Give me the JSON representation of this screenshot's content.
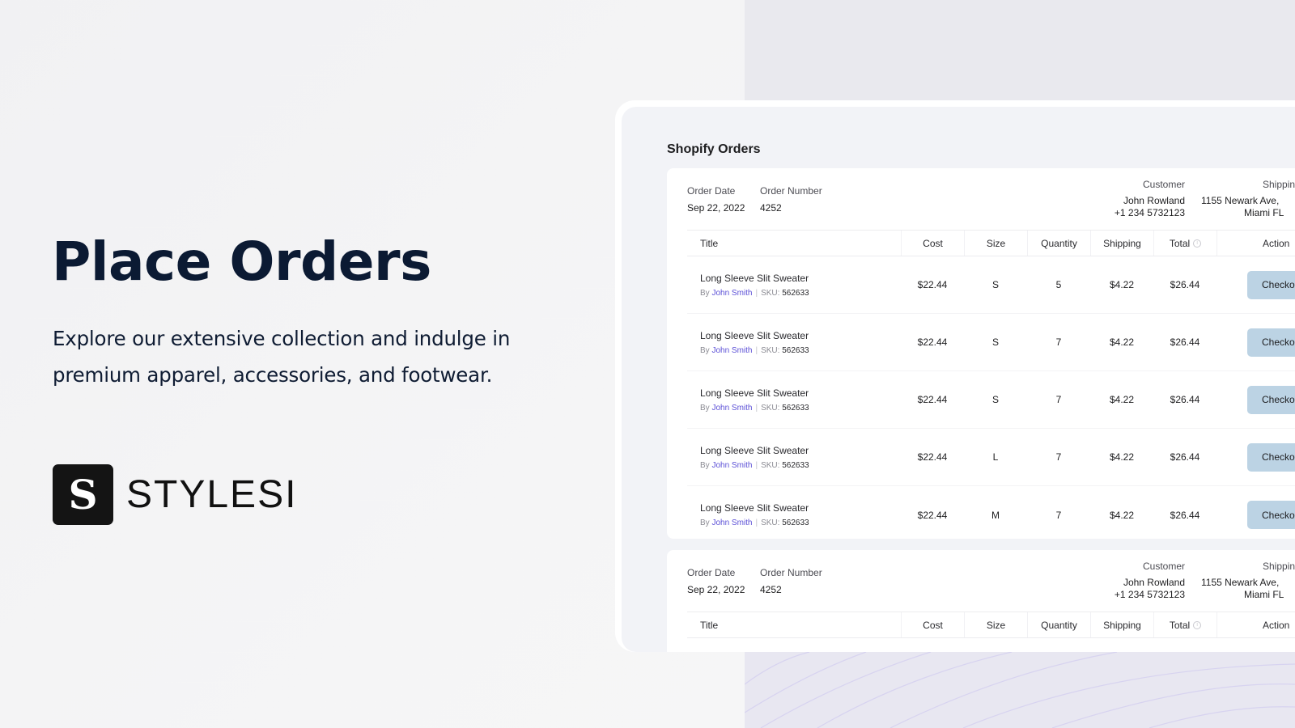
{
  "hero": {
    "title": "Place Orders",
    "subtitle_line1": "Explore our extensive collection and indulge in",
    "subtitle_line2": "premium apparel, accessories, and footwear."
  },
  "brand": {
    "mark": "S",
    "name": "STYLESI"
  },
  "app": {
    "title": "Shopify Orders",
    "columns": {
      "title": "Title",
      "cost": "Cost",
      "size": "Size",
      "quantity": "Quantity",
      "shipping": "Shipping",
      "total": "Total",
      "total_icon": "info-icon",
      "action": "Action"
    },
    "orders": [
      {
        "date_label": "Order Date",
        "date": "Sep 22, 2022",
        "number_label": "Order Number",
        "number": "4252",
        "customer_label": "Customer",
        "customer_name": "John Rowland",
        "customer_phone": "+1 234 5732123",
        "shipping_label": "Shipping",
        "shipping_line1": "1155 Newark Ave,",
        "shipping_line2": "Miami FL",
        "items": [
          {
            "title": "Long Sleeve Slit Sweater",
            "by": "By",
            "author": "John Smith",
            "sku_label": "SKU:",
            "sku": "562633",
            "cost": "$22.44",
            "size": "S",
            "quantity": "5",
            "shipping": "$4.22",
            "total": "$26.44",
            "action": "Checkout"
          },
          {
            "title": "Long Sleeve Slit Sweater",
            "by": "By",
            "author": "John Smith",
            "sku_label": "SKU:",
            "sku": "562633",
            "cost": "$22.44",
            "size": "S",
            "quantity": "7",
            "shipping": "$4.22",
            "total": "$26.44",
            "action": "Checkout"
          },
          {
            "title": "Long Sleeve Slit Sweater",
            "by": "By",
            "author": "John Smith",
            "sku_label": "SKU:",
            "sku": "562633",
            "cost": "$22.44",
            "size": "S",
            "quantity": "7",
            "shipping": "$4.22",
            "total": "$26.44",
            "action": "Checkout"
          },
          {
            "title": "Long Sleeve Slit Sweater",
            "by": "By",
            "author": "John Smith",
            "sku_label": "SKU:",
            "sku": "562633",
            "cost": "$22.44",
            "size": "L",
            "quantity": "7",
            "shipping": "$4.22",
            "total": "$26.44",
            "action": "Checkout"
          },
          {
            "title": "Long Sleeve Slit Sweater",
            "by": "By",
            "author": "John Smith",
            "sku_label": "SKU:",
            "sku": "562633",
            "cost": "$22.44",
            "size": "M",
            "quantity": "7",
            "shipping": "$4.22",
            "total": "$26.44",
            "action": "Checkout"
          }
        ]
      },
      {
        "date_label": "Order Date",
        "date": "Sep 22, 2022",
        "number_label": "Order Number",
        "number": "4252",
        "customer_label": "Customer",
        "customer_name": "John Rowland",
        "customer_phone": "+1 234 5732123",
        "shipping_label": "Shipping",
        "shipping_line1": "1155 Newark Ave,",
        "shipping_line2": "Miami FL",
        "items": []
      }
    ]
  },
  "colors": {
    "hero_text": "#0b1a33",
    "checkout_button": "#bcd3e4",
    "author_link": "#5b4fd6",
    "panel_bg": "#f2f3f7"
  }
}
